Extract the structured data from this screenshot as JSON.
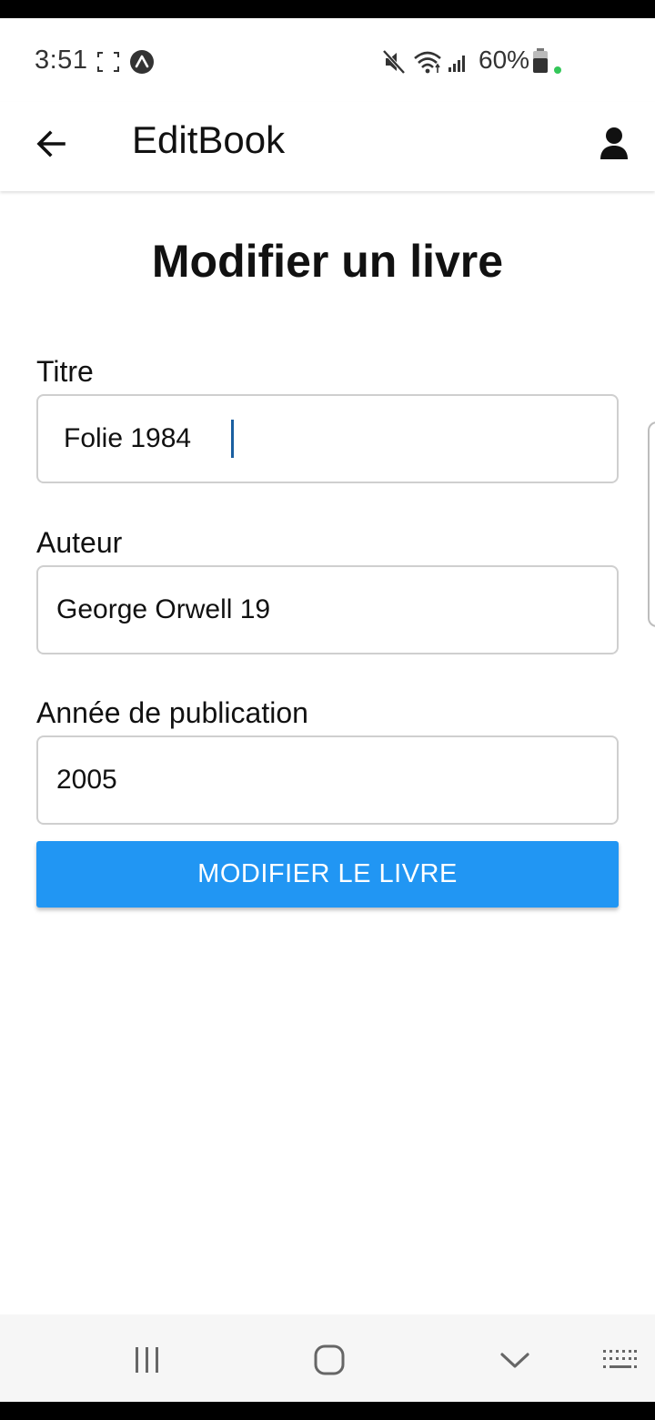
{
  "status_bar": {
    "time": "3:51",
    "battery_percent": "60%",
    "icons": [
      "screenshot-bracket-icon",
      "app-notification-icon",
      "mute-icon",
      "wifi-icon",
      "signal-icon",
      "battery-icon",
      "dot-indicator-icon"
    ],
    "indicator_color": "#34c759"
  },
  "app_bar": {
    "title": "EditBook",
    "back_icon": "arrow-left-icon",
    "profile_icon": "user-icon"
  },
  "page": {
    "heading": "Modifier un livre"
  },
  "form": {
    "title": {
      "label": "Titre",
      "value": "Folie 1984"
    },
    "author": {
      "label": "Auteur",
      "value": "George Orwell 19"
    },
    "year": {
      "label": "Année de publication",
      "value": "2005"
    },
    "submit_label": "MODIFIER LE LIVRE"
  },
  "colors": {
    "accent": "#2196f3",
    "caret": "#1a5fa0"
  },
  "nav_bar": {
    "icons": [
      "recent-apps-icon",
      "home-icon",
      "back-chevron-icon",
      "keyboard-icon"
    ]
  }
}
